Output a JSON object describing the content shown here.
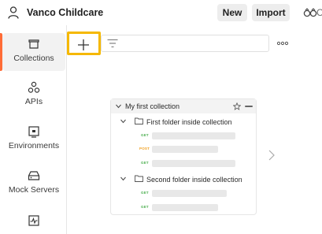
{
  "header": {
    "workspace_name": "Vanco Childcare",
    "new_label": "New",
    "import_label": "Import",
    "cut_text": "C"
  },
  "sidebar": {
    "items": [
      {
        "label": "Collections",
        "icon": "collections-icon",
        "active": true
      },
      {
        "label": "APIs",
        "icon": "apis-icon"
      },
      {
        "label": "Environments",
        "icon": "environments-icon"
      },
      {
        "label": "Mock Servers",
        "icon": "mock-servers-icon"
      },
      {
        "label": "",
        "icon": "monitors-icon"
      }
    ]
  },
  "toolbar": {
    "add_icon": "plus-icon",
    "filter_icon": "filter-icon",
    "more_icon": "more-options-icon"
  },
  "preview": {
    "collection_name": "My first collection",
    "folders": [
      {
        "name": "First folder inside collection",
        "requests": [
          "GET",
          "POST",
          "GET"
        ]
      },
      {
        "name": "Second folder inside collection",
        "requests": [
          "GET",
          "GET"
        ]
      }
    ]
  },
  "colors": {
    "accent": "#ff6c37",
    "highlight": "#f5b800",
    "get": "#4caf50",
    "post": "#f0a020"
  }
}
